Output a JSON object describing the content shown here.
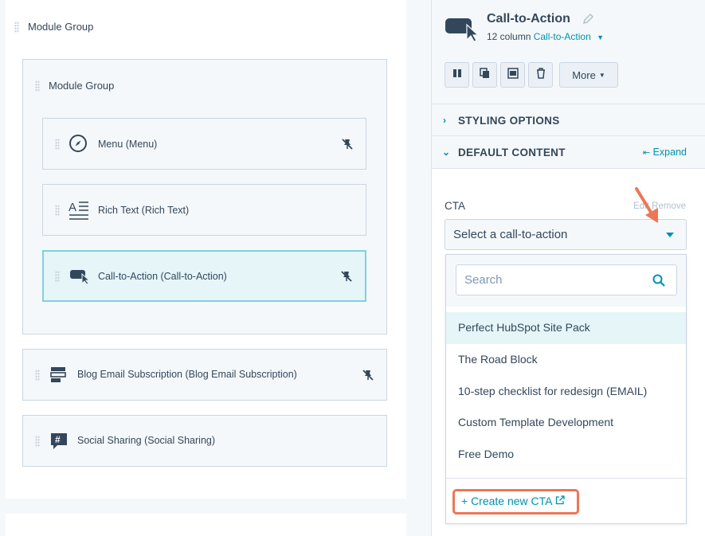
{
  "left": {
    "outer_group_label": "Module Group",
    "inner_group_label": "Module Group",
    "modules": [
      {
        "label": "Menu (Menu)",
        "icon": "compass-icon"
      },
      {
        "label": "Rich Text (Rich Text)",
        "icon": "rich-text-icon"
      },
      {
        "label": "Call-to-Action (Call-to-Action)",
        "icon": "cta-cursor-icon"
      },
      {
        "label": "Blog Email Subscription (Blog Email Subscription)",
        "icon": "form-icon"
      },
      {
        "label": "Social Sharing (Social Sharing)",
        "icon": "hashtag-icon"
      }
    ]
  },
  "panel": {
    "title": "Call-to-Action",
    "subtitle_prefix": "12 column",
    "subtitle_link": "Call-to-Action",
    "toolbar": {
      "more_label": "More"
    },
    "sections": {
      "styling": "STYLING OPTIONS",
      "default_content": "DEFAULT CONTENT",
      "expand": "Expand"
    },
    "cta": {
      "label": "CTA",
      "edit": "Edit",
      "remove": "Remove",
      "select_value": "Select a call-to-action",
      "search_placeholder": "Search",
      "options": [
        "Perfect HubSpot Site Pack",
        "The Road Block",
        "10-step checklist for redesign (EMAIL)",
        "Custom Template Development",
        "Free Demo"
      ],
      "create_label": "+ Create new CTA"
    }
  },
  "colors": {
    "accent": "#0091ae",
    "annotation": "#ec7656",
    "selected_bg": "#e5f5f8",
    "text": "#33475b"
  }
}
